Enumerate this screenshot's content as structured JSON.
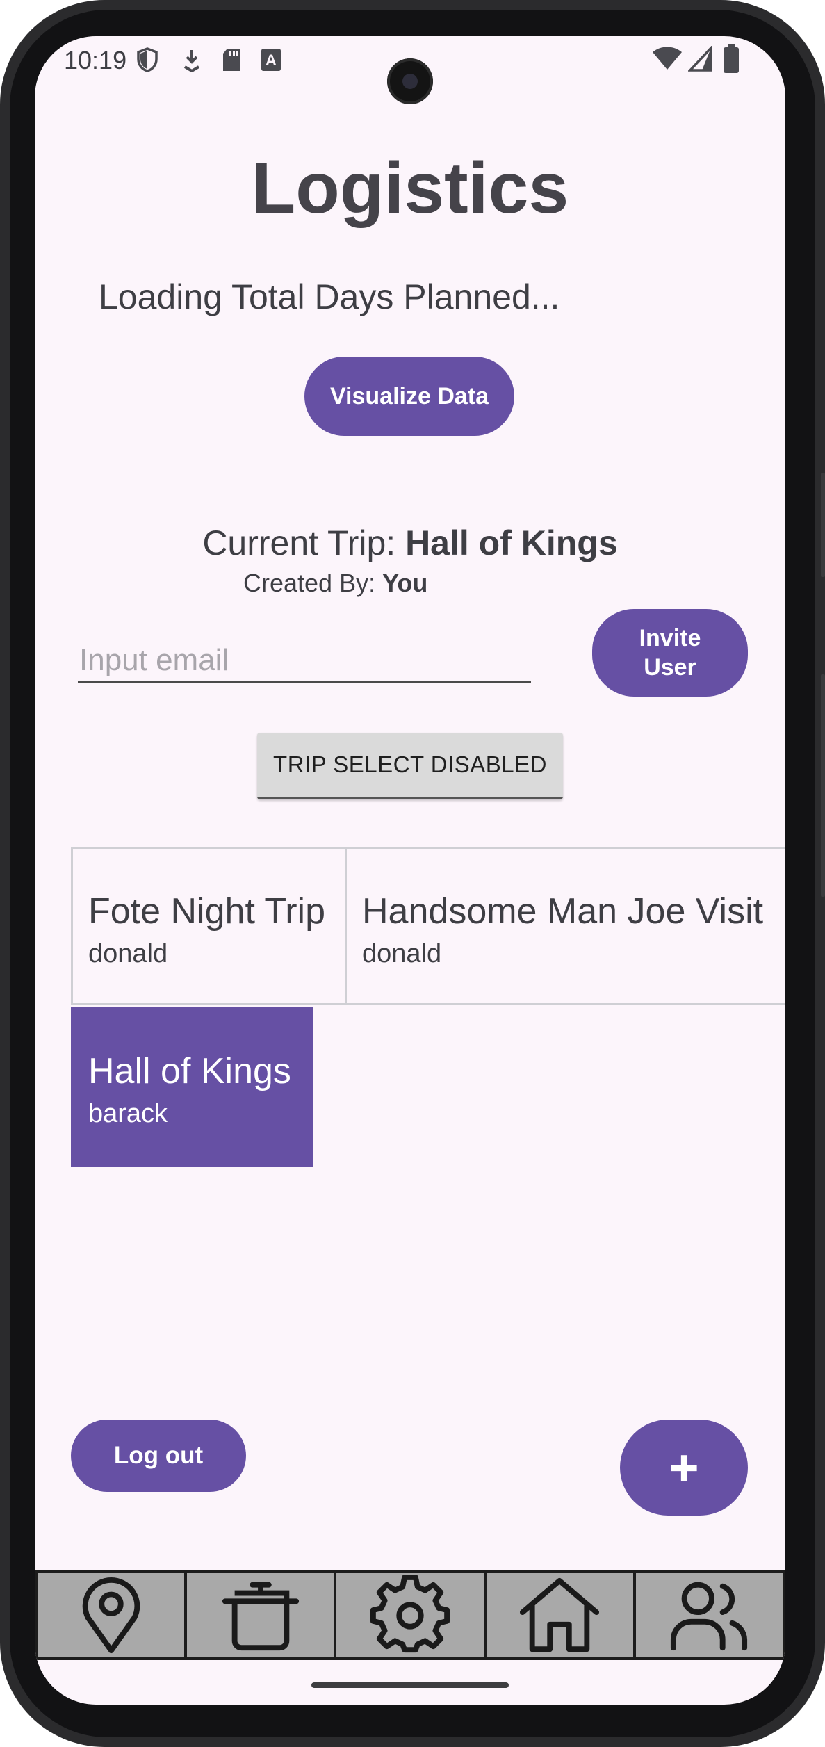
{
  "status_bar": {
    "time": "10:19"
  },
  "page": {
    "title": "Logistics",
    "loading_text": "Loading Total Days Planned...",
    "visualize_button": "Visualize Data"
  },
  "current_trip": {
    "label": "Current Trip: ",
    "name": "Hall of Kings",
    "created_by_label": "Created By: ",
    "created_by": "You"
  },
  "invite": {
    "email_placeholder": "Input email",
    "email_value": "",
    "button_label": "Invite User"
  },
  "trip_select": {
    "label": "TRIP SELECT DISABLED"
  },
  "trips": [
    {
      "name": "Fote Night Trip",
      "owner": "donald"
    },
    {
      "name": "Handsome Man Joe Visit",
      "owner": "donald"
    },
    {
      "name": "Hall of Kings",
      "owner": "barack"
    }
  ],
  "actions": {
    "logout_label": "Log out",
    "add_label": "+"
  },
  "bottom_nav": [
    "location-pin-icon",
    "cooking-pot-icon",
    "gear-icon",
    "home-icon",
    "users-icon"
  ],
  "colors": {
    "accent": "#6650a4",
    "background": "#fcf5fb",
    "nav_background": "#a9a9a9"
  }
}
